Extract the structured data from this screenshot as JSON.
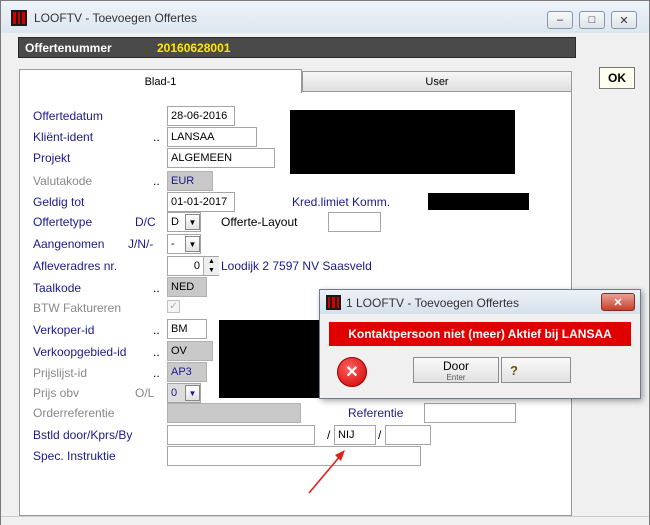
{
  "window": {
    "title": "LOOFTV - Toevoegen Offertes"
  },
  "header": {
    "label": "Offertenummer",
    "value": "20160628001"
  },
  "ok_label": "OK",
  "tabs": [
    {
      "label": "Blad-1"
    },
    {
      "label": "User"
    }
  ],
  "form": {
    "offertedatum": {
      "label": "Offertedatum",
      "value": "28-06-2016"
    },
    "klient": {
      "label": "Kliënt-ident",
      "dots": "..",
      "value": "LANSAA"
    },
    "projekt": {
      "label": "Projekt",
      "value": "ALGEMEEN"
    },
    "valutakode": {
      "label": "Valutakode",
      "dots": "..",
      "value": "EUR"
    },
    "geldig_tot": {
      "label": "Geldig tot",
      "value": "01-01-2017"
    },
    "kred_limiet_label": "Kred.limiet Komm.",
    "offertetype": {
      "label": "Offertetype",
      "hint": "D/C",
      "value": "D"
    },
    "offerte_layout_label": "Offerte-Layout",
    "aangenomen": {
      "label": "Aangenomen",
      "hint": "J/N/-",
      "value": "-"
    },
    "afleveradres": {
      "label": "Afleveradres nr.",
      "value": "0",
      "address": "Loodijk 2  7597 NV  Saasveld"
    },
    "taalkode": {
      "label": "Taalkode",
      "dots": "..",
      "value": "NED"
    },
    "btw_label": "BTW Faktureren",
    "verkoper": {
      "label": "Verkoper-id",
      "dots": "..",
      "value": "BM"
    },
    "verkoopgebied": {
      "label": "Verkoopgebied-id",
      "dots": "..",
      "value": "OV"
    },
    "prijslijst": {
      "label": "Prijslijst-id",
      "dots": "..",
      "value": "AP3"
    },
    "prijs_obv": {
      "label": "Prijs obv",
      "hint": "O/L",
      "value": "0"
    },
    "orderreferentie_label": "Orderreferentie",
    "referentie_label": "Referentie",
    "bstld": {
      "label": "Bstld door/Kprs/By",
      "sep1": "/",
      "kprs_value": "NIJ",
      "sep2": "/"
    },
    "spec_label": "Spec. Instruktie"
  },
  "dialog": {
    "title": "1 LOOFTV - Toevoegen Offertes",
    "message": "Kontaktpersoon niet (meer) Aktief bij LANSAA",
    "door_label": "Door",
    "door_sub": "Enter",
    "help_label": "?"
  },
  "colors": {
    "error": "#e00000",
    "header_value": "#ffe800",
    "label": "#1a1a8c",
    "arrow": "#e0201c"
  },
  "icons": [
    "app-logo-icon",
    "minimize-icon",
    "maximize-icon",
    "close-icon",
    "dropdown-arrow-icon",
    "spinner-icon",
    "checkbox-icon",
    "error-icon",
    "help-icon"
  ]
}
